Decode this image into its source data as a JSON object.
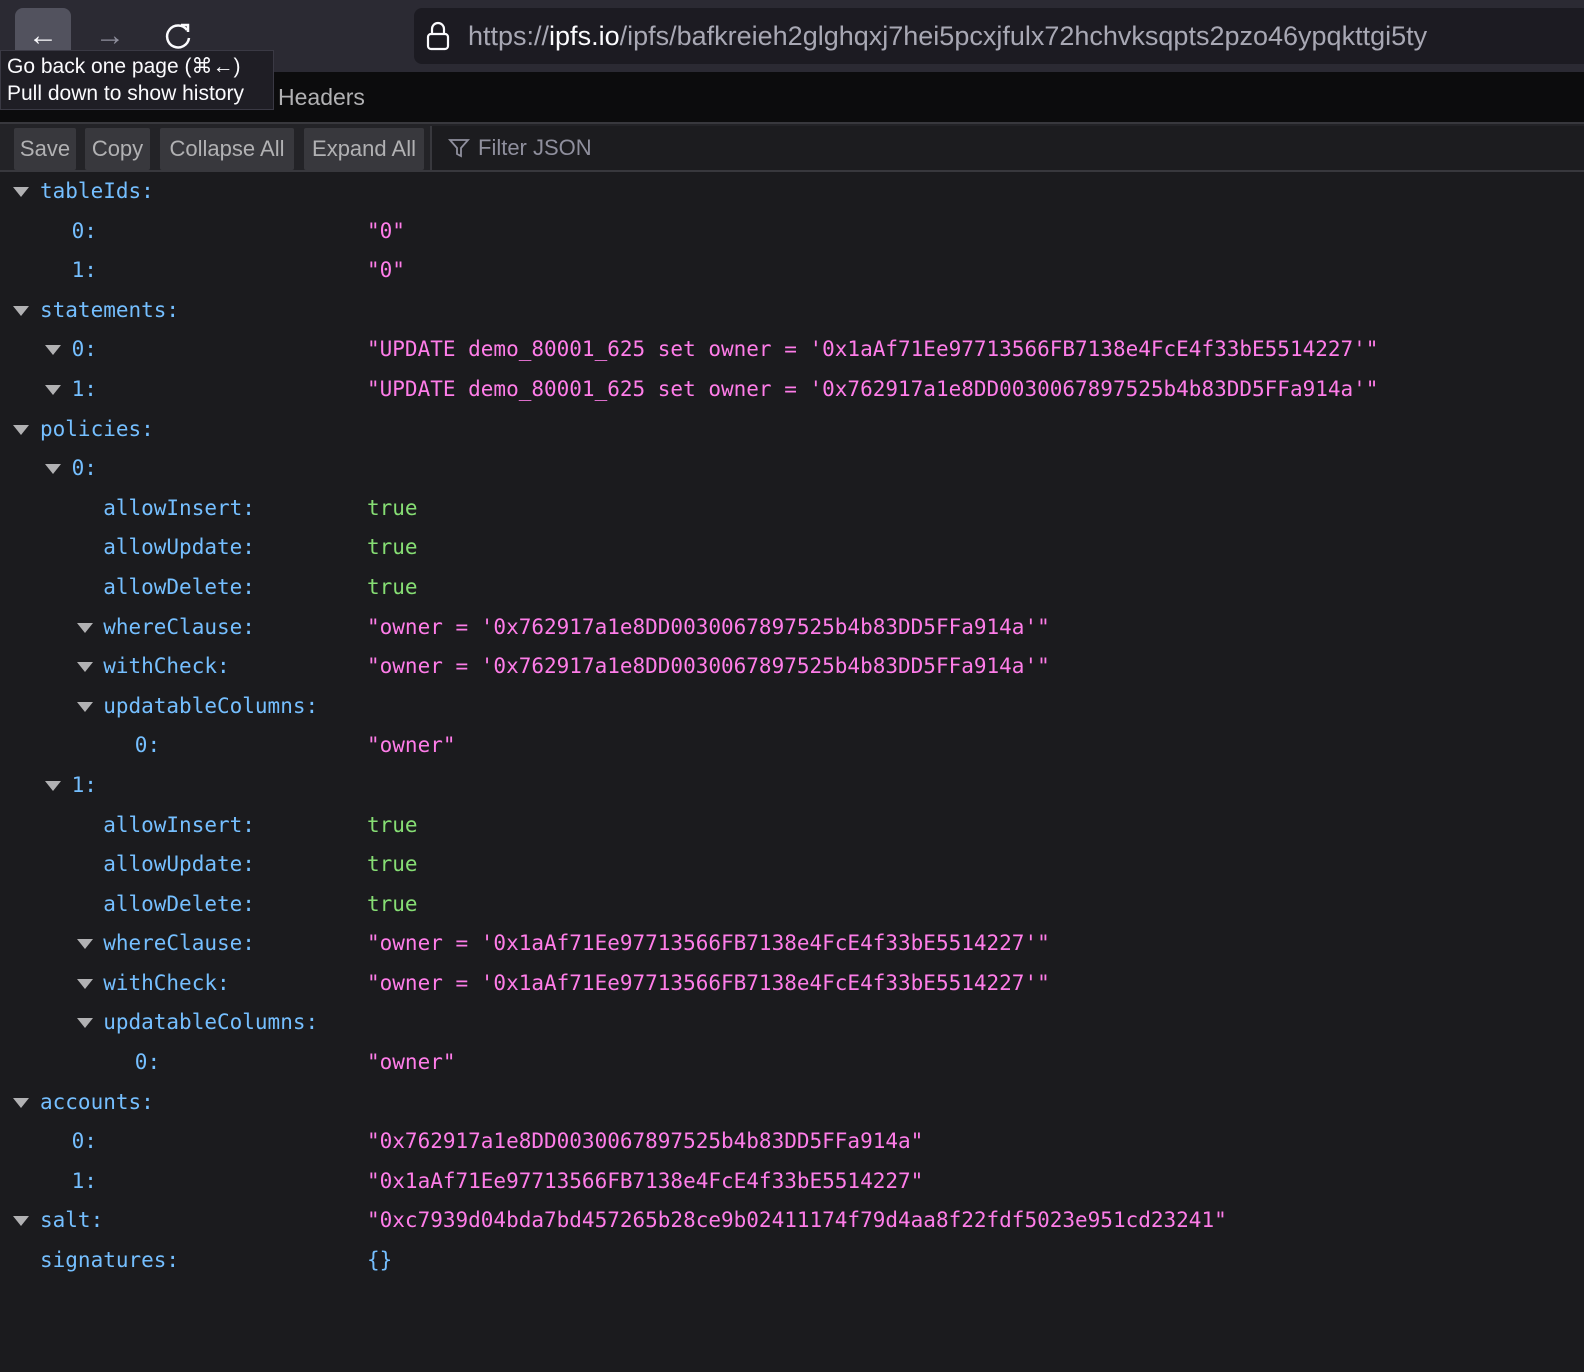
{
  "browser": {
    "url_prefix": "https://",
    "url_host": "ipfs.io",
    "url_path": "/ipfs/bafkreieh2glghqxj7hei5pcxjfulx72hchvksqpts2pzo46ypqkttgi5ty",
    "tooltip_line1": "Go back one page (⌘←)",
    "tooltip_line2": "Pull down to show history"
  },
  "tabs": {
    "headers": "Headers"
  },
  "toolbar": {
    "save": "Save",
    "copy": "Copy",
    "collapse_all": "Collapse All",
    "expand_all": "Expand All",
    "filter_placeholder": "Filter JSON"
  },
  "colors": {
    "key": "#75bfff",
    "string": "#ff7de9",
    "boolean": "#86de74"
  },
  "rows": [
    {
      "depth": 0,
      "expanded": true,
      "key": "tableIds:",
      "value": "",
      "type": ""
    },
    {
      "depth": 1,
      "expanded": false,
      "key": "0:",
      "value": "\"0\"",
      "type": "string"
    },
    {
      "depth": 1,
      "expanded": false,
      "key": "1:",
      "value": "\"0\"",
      "type": "string"
    },
    {
      "depth": 0,
      "expanded": true,
      "key": "statements:",
      "value": "",
      "type": ""
    },
    {
      "depth": 1,
      "expanded": true,
      "key": "0:",
      "value": "\"UPDATE demo_80001_625 set owner = '0x1aAf71Ee97713566FB7138e4FcE4f33bE5514227'\"",
      "type": "string"
    },
    {
      "depth": 1,
      "expanded": true,
      "key": "1:",
      "value": "\"UPDATE demo_80001_625 set owner = '0x762917a1e8DD0030067897525b4b83DD5FFa914a'\"",
      "type": "string"
    },
    {
      "depth": 0,
      "expanded": true,
      "key": "policies:",
      "value": "",
      "type": ""
    },
    {
      "depth": 1,
      "expanded": true,
      "key": "0:",
      "value": "",
      "type": ""
    },
    {
      "depth": 2,
      "expanded": false,
      "key": "allowInsert:",
      "value": "true",
      "type": "bool"
    },
    {
      "depth": 2,
      "expanded": false,
      "key": "allowUpdate:",
      "value": "true",
      "type": "bool"
    },
    {
      "depth": 2,
      "expanded": false,
      "key": "allowDelete:",
      "value": "true",
      "type": "bool"
    },
    {
      "depth": 2,
      "expanded": true,
      "key": "whereClause:",
      "value": "\"owner = '0x762917a1e8DD0030067897525b4b83DD5FFa914a'\"",
      "type": "string"
    },
    {
      "depth": 2,
      "expanded": true,
      "key": "withCheck:",
      "value": "\"owner = '0x762917a1e8DD0030067897525b4b83DD5FFa914a'\"",
      "type": "string"
    },
    {
      "depth": 2,
      "expanded": true,
      "key": "updatableColumns:",
      "value": "",
      "type": ""
    },
    {
      "depth": 3,
      "expanded": false,
      "key": "0:",
      "value": "\"owner\"",
      "type": "string"
    },
    {
      "depth": 1,
      "expanded": true,
      "key": "1:",
      "value": "",
      "type": ""
    },
    {
      "depth": 2,
      "expanded": false,
      "key": "allowInsert:",
      "value": "true",
      "type": "bool"
    },
    {
      "depth": 2,
      "expanded": false,
      "key": "allowUpdate:",
      "value": "true",
      "type": "bool"
    },
    {
      "depth": 2,
      "expanded": false,
      "key": "allowDelete:",
      "value": "true",
      "type": "bool"
    },
    {
      "depth": 2,
      "expanded": true,
      "key": "whereClause:",
      "value": "\"owner = '0x1aAf71Ee97713566FB7138e4FcE4f33bE5514227'\"",
      "type": "string"
    },
    {
      "depth": 2,
      "expanded": true,
      "key": "withCheck:",
      "value": "\"owner = '0x1aAf71Ee97713566FB7138e4FcE4f33bE5514227'\"",
      "type": "string"
    },
    {
      "depth": 2,
      "expanded": true,
      "key": "updatableColumns:",
      "value": "",
      "type": ""
    },
    {
      "depth": 3,
      "expanded": false,
      "key": "0:",
      "value": "\"owner\"",
      "type": "string"
    },
    {
      "depth": 0,
      "expanded": true,
      "key": "accounts:",
      "value": "",
      "type": ""
    },
    {
      "depth": 1,
      "expanded": false,
      "key": "0:",
      "value": "\"0x762917a1e8DD0030067897525b4b83DD5FFa914a\"",
      "type": "string"
    },
    {
      "depth": 1,
      "expanded": false,
      "key": "1:",
      "value": "\"0x1aAf71Ee97713566FB7138e4FcE4f33bE5514227\"",
      "type": "string"
    },
    {
      "depth": 0,
      "expanded": true,
      "key": "salt:",
      "value": "\"0xc7939d04bda7bd457265b28ce9b02411174f79d4aa8f22fdf5023e951cd23241\"",
      "type": "string"
    },
    {
      "depth": 0,
      "expanded": false,
      "key": "signatures:",
      "value": "{}",
      "type": "obj"
    }
  ]
}
